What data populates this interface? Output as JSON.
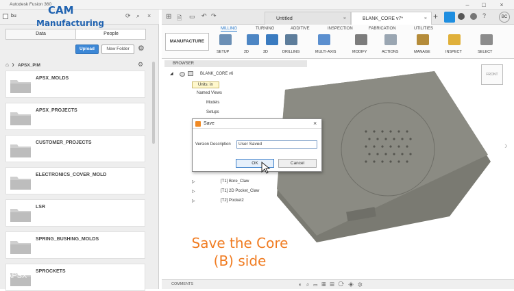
{
  "window": {
    "title": "Autodesk Fusion 360"
  },
  "logo": {
    "line1": "CAM",
    "line2": "Manufacturing"
  },
  "left_panel": {
    "search_value": "bu",
    "tabs": [
      "Data",
      "People"
    ],
    "upload_label": "Upload",
    "new_folder_label": "New Folder",
    "project": "APSX_PIM",
    "folders": [
      "APSX_MOLDS",
      "APSX_PROJECTS",
      "CUSTOMER_PROJECTS",
      "ELECTRONICS_COVER_MOLD",
      "LSR",
      "SPRING_BUSHING_MOLDS",
      "SPROCKETS"
    ]
  },
  "doc_tabs": [
    {
      "label": "Untitled"
    },
    {
      "label": "BLANK_CORE v7*"
    }
  ],
  "ribbon": {
    "workspace": "MANUFACTURE",
    "tabs": [
      "MILLING",
      "TURNING",
      "ADDITIVE",
      "INSPECTION",
      "FABRICATION",
      "UTILITIES"
    ],
    "groups": [
      "SETUP",
      "2D",
      "3D",
      "DRILLING",
      "MULTI-AXIS",
      "MODIFY",
      "ACTIONS",
      "MANAGE",
      "INSPECT",
      "SELECT"
    ]
  },
  "browser": {
    "header": "BROWSER",
    "root": "BLANK_CORE v6",
    "items": [
      "Units: in",
      "Named Views",
      "Models",
      "Setups",
      "[T1] Bore_Claw",
      "[T1] 2D Pocket_Claw",
      "[T2] Pocket2"
    ]
  },
  "dialog": {
    "title": "Save",
    "field_label": "Version Description",
    "field_value": "User Saved",
    "ok_label": "OK",
    "cancel_label": "Cancel"
  },
  "viewcube": {
    "label": "FRONT"
  },
  "bottom": {
    "comments_label": "COMMENTS"
  },
  "caption": {
    "line1": "Save the Core",
    "line2": "(B) side"
  },
  "overlay_text": "APSX"
}
